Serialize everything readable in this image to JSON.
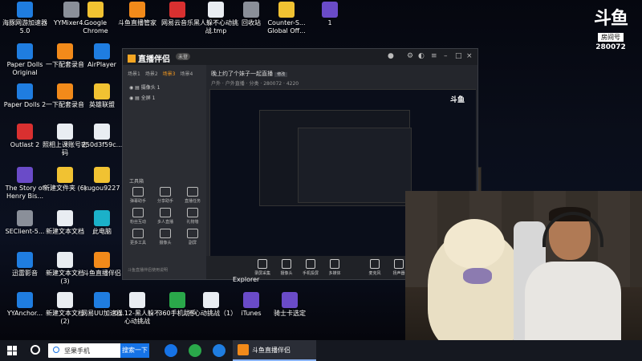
{
  "desktop_icons": [
    {
      "id": "haizuo",
      "label": "海豚网游加速器5.0",
      "color": "blue"
    },
    {
      "id": "yymixer",
      "label": "YYMixer4...",
      "color": "gray"
    },
    {
      "id": "chrome",
      "label": "Google Chrome",
      "color": "yellow"
    },
    {
      "id": "douyu-mgr",
      "label": "斗鱼直播管家",
      "color": "orange"
    },
    {
      "id": "netease",
      "label": "网易云音乐",
      "color": "red"
    },
    {
      "id": "tmp1",
      "label": "黑人躲不心动挑战.tmp",
      "color": "white"
    },
    {
      "id": "recycle",
      "label": "回收站",
      "color": "gray"
    },
    {
      "id": "csgo",
      "label": "Counter-S... Global Off...",
      "color": "yellow"
    },
    {
      "id": "one",
      "label": "1",
      "color": "purple"
    },
    {
      "id": "paper1",
      "label": "Paper Dolls Original",
      "color": "blue"
    },
    {
      "id": "record1",
      "label": "一下配套录音",
      "color": "orange"
    },
    {
      "id": "airplayer",
      "label": "AirPlayer",
      "color": "blue"
    },
    {
      "id": "paper2",
      "label": "Paper Dolls 2",
      "color": "blue"
    },
    {
      "id": "record2",
      "label": "一下配套录音",
      "color": "orange"
    },
    {
      "id": "lol",
      "label": "英雄联盟",
      "color": "yellow"
    },
    {
      "id": "outlast",
      "label": "Outlast 2",
      "color": "red"
    },
    {
      "id": "pwd",
      "label": "照相上课账号密码",
      "color": "white"
    },
    {
      "id": "file250",
      "label": "250d3f59c...",
      "color": "white"
    },
    {
      "id": "henry",
      "label": "The Story of Henry Bis...",
      "color": "purple"
    },
    {
      "id": "newfolder",
      "label": "新建文件夹 (6)",
      "color": "yellow"
    },
    {
      "id": "kugou",
      "label": "kugou9227",
      "color": "yellow"
    },
    {
      "id": "seclient",
      "label": "SEClient-5...",
      "color": "gray"
    },
    {
      "id": "newtxt1",
      "label": "新建文本文档",
      "color": "white"
    },
    {
      "id": "pc",
      "label": "此电脑",
      "color": "teal"
    },
    {
      "id": "xunlei",
      "label": "迅雷影音",
      "color": "blue"
    },
    {
      "id": "newtxt3",
      "label": "新建文本文档 (3)",
      "color": "white"
    },
    {
      "id": "douyu-comp",
      "label": "斗鱼直播伴侣",
      "color": "orange"
    },
    {
      "id": "yyanchor",
      "label": "YYAnchor...",
      "color": "blue"
    },
    {
      "id": "newtxt2",
      "label": "新建文本文档 (2)",
      "color": "white"
    },
    {
      "id": "uu",
      "label": "网易UU加速器",
      "color": "blue"
    },
    {
      "id": "challenge",
      "label": "01.12-黑人躲不心动挑战",
      "color": "white"
    },
    {
      "id": "360",
      "label": "360手机助手",
      "color": "green"
    },
    {
      "id": "challenge2",
      "label": "不心动挑战（1）",
      "color": "white"
    },
    {
      "id": "itunes",
      "label": "iTunes",
      "color": "purple"
    },
    {
      "id": "qishi",
      "label": "骑士卡选定",
      "color": "purple"
    }
  ],
  "explorer_label": "Explorer",
  "douyu_badge": {
    "logo": "斗鱼",
    "room_label": "房间号",
    "room_number": "280072"
  },
  "obs": {
    "brand": "直播伴侣",
    "brand_badge": "未登",
    "tabs": [
      "场景1",
      "场景2",
      "场景3",
      "场景4"
    ],
    "active_tab": 2,
    "scenes": [
      "摄像头 1",
      "全屏 1"
    ],
    "tools_title": "工具箱",
    "tools": [
      "弹幕助手",
      "分享助手",
      "直播任务",
      "粉丝互动",
      "多人直播",
      "礼物墙",
      "更多工具",
      "摄像头",
      "副屏"
    ],
    "stream_title": "晚上约了个妹子一起直播",
    "stream_title_badge": "修改",
    "stream_meta": [
      "户外 · 户外直播",
      "分类",
      "280072",
      "4220"
    ],
    "bottom_buttons": [
      "录屏采集",
      "摄像头",
      "手机投屏",
      "多媒体",
      "麦克风",
      "扬声器"
    ],
    "status": "斗鱼直播伴侣使用说明"
  },
  "taskbar": {
    "search_value": "坚果手机",
    "search_button": "搜索一下",
    "active_app": "斗鱼直播伴侣"
  }
}
